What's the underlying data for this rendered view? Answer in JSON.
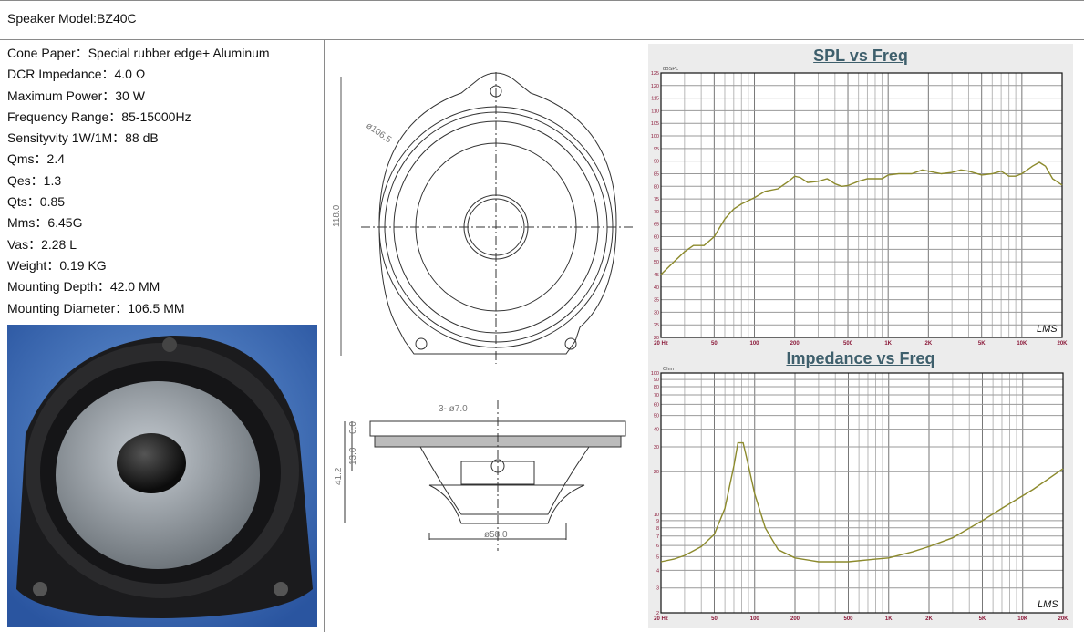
{
  "header": {
    "model": "Speaker Model:BZ40C"
  },
  "specs": [
    "Cone Paper：Special rubber edge+ Aluminum",
    "DCR Impedance：4.0 Ω",
    "Maximum Power：30 W",
    "Frequency Range：85-15000Hz",
    "Sensityvity 1W/1M：88 dB",
    "Qms：2.4",
    "Qes：1.3",
    "Qts：0.85",
    "Mms：6.45G",
    "Vas：2.28 L",
    "Weight：0.19 KG",
    "Mounting Depth：42.0 MM",
    "Mounting Diameter：106.5 MM"
  ],
  "drawing": {
    "dia": "ø106.5",
    "height": "118.0",
    "holes": "3- ø7.0",
    "d6": "6.0",
    "d13": "13.0",
    "d41": "41.2",
    "d58": "ø58.0"
  },
  "colors": {
    "curve": "#8c8a2c",
    "tick": "#8b1a3a",
    "title": "#3e5f6c",
    "photo_bg": "#2f5fa8"
  },
  "chart_data": [
    {
      "type": "line",
      "title": "SPL vs Freq",
      "ylabel": "dBSPL",
      "xscale": "log",
      "ylim": [
        20,
        125
      ],
      "xlim": [
        20,
        20000
      ],
      "yticks": [
        20,
        25,
        30,
        35,
        40,
        45,
        50,
        55,
        60,
        65,
        70,
        75,
        80,
        85,
        90,
        95,
        100,
        105,
        110,
        115,
        120,
        125
      ],
      "xticks": [
        {
          "v": 20,
          "l": "20 Hz"
        },
        {
          "v": 50,
          "l": "50"
        },
        {
          "v": 100,
          "l": "100"
        },
        {
          "v": 200,
          "l": "200"
        },
        {
          "v": 500,
          "l": "500"
        },
        {
          "v": 1000,
          "l": "1K"
        },
        {
          "v": 2000,
          "l": "2K"
        },
        {
          "v": 5000,
          "l": "5K"
        },
        {
          "v": 10000,
          "l": "10K"
        },
        {
          "v": 20000,
          "l": "20K"
        }
      ],
      "watermark": "LMS",
      "grid": true,
      "x": [
        20,
        25,
        30,
        35,
        42,
        50,
        60,
        70,
        80,
        100,
        120,
        150,
        180,
        200,
        220,
        250,
        300,
        350,
        400,
        450,
        500,
        600,
        700,
        800,
        900,
        1000,
        1200,
        1500,
        1800,
        2000,
        2500,
        3000,
        3500,
        4000,
        5000,
        6000,
        7000,
        8000,
        9000,
        10000,
        12000,
        13500,
        15000,
        17000,
        20000
      ],
      "y": [
        45,
        50,
        54,
        56.5,
        56.5,
        60,
        67,
        71,
        73,
        75.5,
        78,
        79,
        82,
        84,
        83.5,
        81.5,
        82,
        83,
        81,
        80,
        80.3,
        82,
        83,
        83,
        83,
        84.5,
        85,
        85,
        86.5,
        86,
        85,
        85.5,
        86.5,
        86,
        84.5,
        85,
        86,
        84,
        84,
        85,
        88,
        89.5,
        88,
        83,
        80.5
      ]
    },
    {
      "type": "line",
      "title": "Impedance vs Freq",
      "ylabel": "Ohm",
      "xscale": "log",
      "yscale": "log",
      "ylim": [
        2,
        100
      ],
      "xlim": [
        20,
        20000
      ],
      "yticks": [
        2,
        3,
        4,
        5,
        6,
        7,
        8,
        9,
        10,
        20,
        30,
        40,
        50,
        60,
        70,
        80,
        90,
        100
      ],
      "xticks": [
        {
          "v": 20,
          "l": "20 Hz"
        },
        {
          "v": 50,
          "l": "50"
        },
        {
          "v": 100,
          "l": "100"
        },
        {
          "v": 200,
          "l": "200"
        },
        {
          "v": 500,
          "l": "500"
        },
        {
          "v": 1000,
          "l": "1K"
        },
        {
          "v": 2000,
          "l": "2K"
        },
        {
          "v": 5000,
          "l": "5K"
        },
        {
          "v": 10000,
          "l": "10K"
        },
        {
          "v": 20000,
          "l": "20K"
        }
      ],
      "watermark": "LMS",
      "grid": true,
      "x": [
        20,
        25,
        30,
        40,
        50,
        60,
        70,
        75,
        82,
        90,
        100,
        120,
        150,
        200,
        300,
        500,
        800,
        1000,
        1500,
        2000,
        3000,
        5000,
        7000,
        10000,
        12000,
        20000
      ],
      "y": [
        4.6,
        4.8,
        5.1,
        5.9,
        7.2,
        11,
        22,
        32,
        32,
        22,
        14,
        8,
        5.6,
        4.9,
        4.6,
        4.6,
        4.8,
        4.9,
        5.4,
        5.9,
        6.8,
        9,
        11,
        13.5,
        15,
        21
      ]
    }
  ]
}
